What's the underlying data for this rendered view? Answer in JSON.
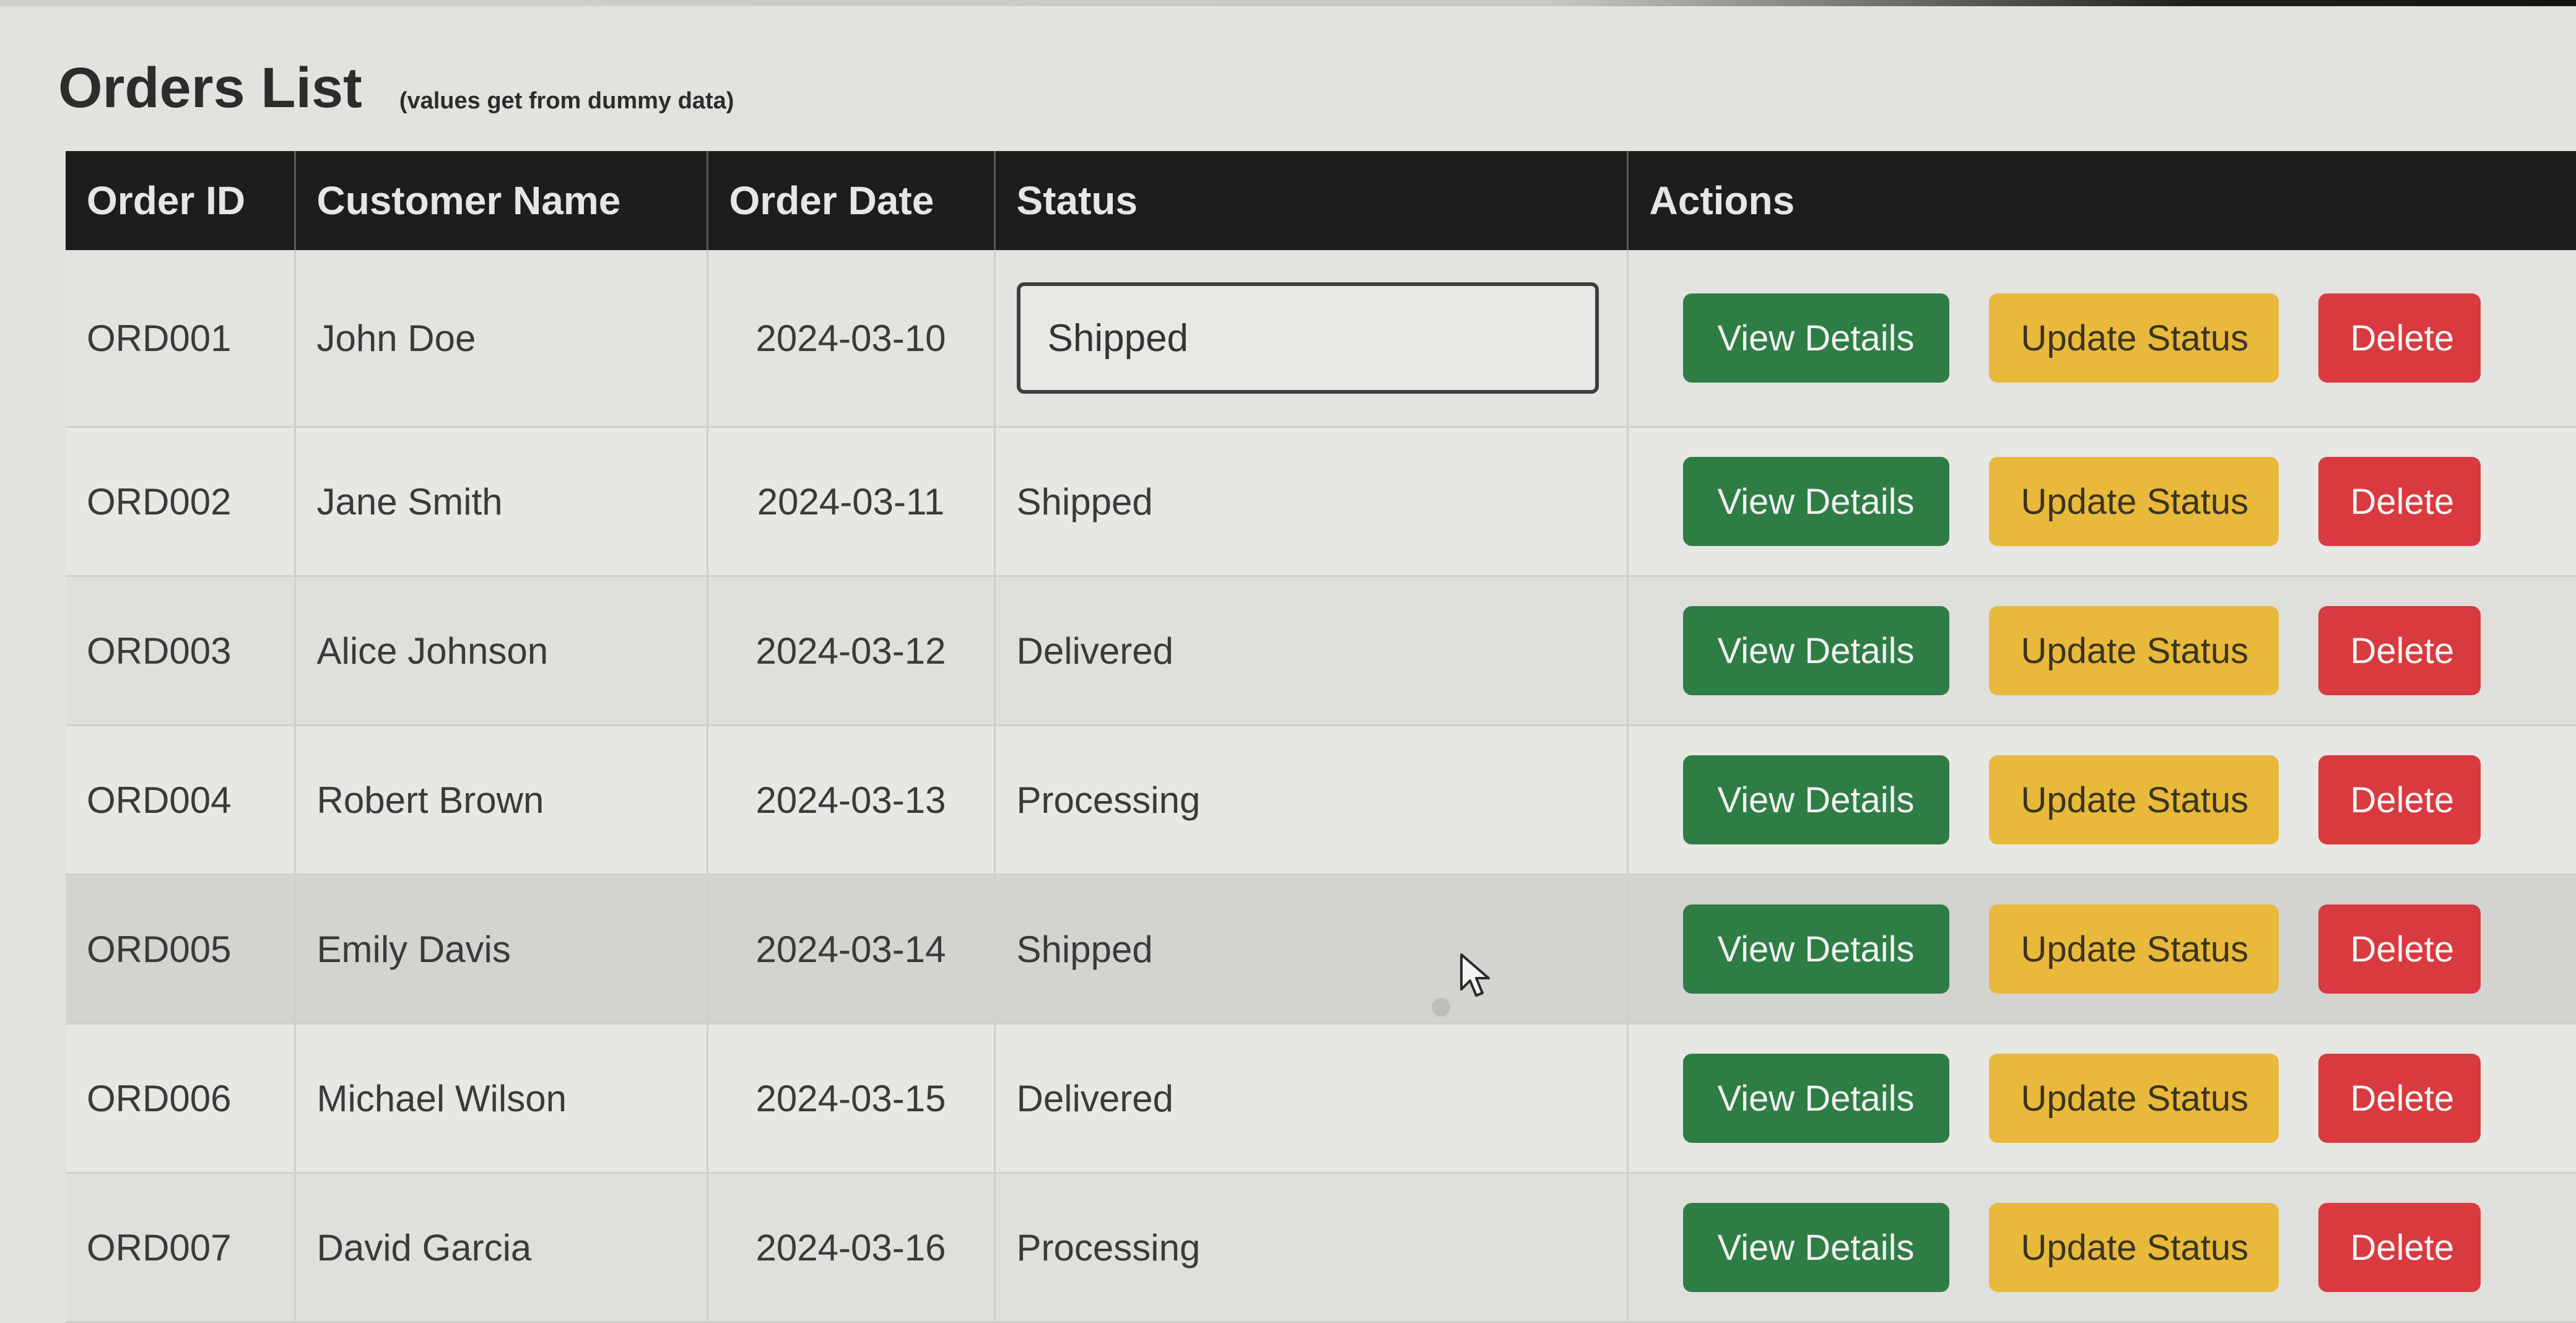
{
  "page": {
    "title": "Orders List",
    "subtitle": "(values get from dummy data)"
  },
  "table": {
    "columns": [
      "Order ID",
      "Customer Name",
      "Order Date",
      "Status",
      "Actions"
    ],
    "rows": [
      {
        "id": "ORD001",
        "customer": "John Doe",
        "date": "2024-03-10",
        "status": "Shipped",
        "editing": true
      },
      {
        "id": "ORD002",
        "customer": "Jane Smith",
        "date": "2024-03-11",
        "status": "Shipped"
      },
      {
        "id": "ORD003",
        "customer": "Alice Johnson",
        "date": "2024-03-12",
        "status": "Delivered"
      },
      {
        "id": "ORD004",
        "customer": "Robert Brown",
        "date": "2024-03-13",
        "status": "Processing"
      },
      {
        "id": "ORD005",
        "customer": "Emily Davis",
        "date": "2024-03-14",
        "status": "Shipped"
      },
      {
        "id": "ORD006",
        "customer": "Michael Wilson",
        "date": "2024-03-15",
        "status": "Delivered"
      },
      {
        "id": "ORD007",
        "customer": "David Garcia",
        "date": "2024-03-16",
        "status": "Processing"
      }
    ]
  },
  "actions": {
    "view_label": "View Details",
    "update_label": "Update Status",
    "delete_label": "Delete"
  },
  "colors": {
    "header_bg": "#1b1d1f",
    "view_button": "#2e7d45",
    "update_button": "#e8b93a",
    "delete_button": "#d93a3f"
  },
  "icons": {
    "cursor": "mouse-pointer-icon"
  }
}
